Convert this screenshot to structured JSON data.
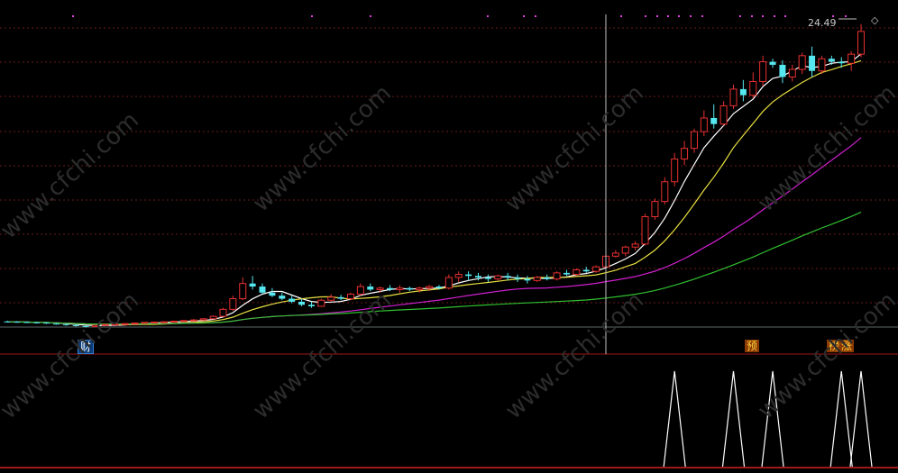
{
  "price_label": "24.49",
  "diamond_glyph": "◇",
  "badges": {
    "cai": "财",
    "yu": "预",
    "bang": "榜",
    "zhang": "涨"
  },
  "watermark_text": "www.cfchi.com",
  "colors": {
    "up": "#e83030",
    "down": "#55e8f0",
    "ma1": "#ffffff",
    "ma2": "#e8e040",
    "ma3": "#d020d0",
    "ma4": "#30c030",
    "grid": "#6a1a1a",
    "cursor": "#c0c0c0",
    "signal": "#ffffff"
  },
  "chart_data": {
    "type": "candlestick",
    "candles": [
      [
        4.9,
        4.95,
        4.84,
        4.88
      ],
      [
        4.88,
        4.92,
        4.82,
        4.86
      ],
      [
        4.86,
        4.9,
        4.8,
        4.84
      ],
      [
        4.84,
        4.88,
        4.78,
        4.82
      ],
      [
        4.82,
        4.85,
        4.74,
        4.76
      ],
      [
        4.76,
        4.8,
        4.7,
        4.72
      ],
      [
        4.72,
        4.76,
        4.62,
        4.66
      ],
      [
        4.66,
        4.7,
        4.56,
        4.6
      ],
      [
        4.6,
        4.64,
        4.5,
        4.56
      ],
      [
        4.56,
        4.66,
        4.54,
        4.64
      ],
      [
        4.64,
        4.72,
        4.6,
        4.7
      ],
      [
        4.7,
        4.76,
        4.66,
        4.72
      ],
      [
        4.72,
        4.78,
        4.68,
        4.76
      ],
      [
        4.76,
        4.82,
        4.72,
        4.8
      ],
      [
        4.8,
        4.86,
        4.76,
        4.84
      ],
      [
        4.84,
        4.9,
        4.8,
        4.86
      ],
      [
        4.86,
        4.92,
        4.82,
        4.88
      ],
      [
        4.88,
        4.96,
        4.84,
        4.92
      ],
      [
        4.92,
        5.0,
        4.88,
        4.96
      ],
      [
        4.96,
        5.06,
        4.92,
        5.0
      ],
      [
        5.0,
        5.1,
        4.96,
        5.08
      ],
      [
        5.08,
        5.3,
        5.04,
        5.24
      ],
      [
        5.24,
        5.8,
        5.2,
        5.7
      ],
      [
        5.7,
        6.6,
        5.6,
        6.4
      ],
      [
        6.4,
        7.8,
        6.3,
        7.4
      ],
      [
        7.4,
        7.9,
        7.0,
        7.2
      ],
      [
        7.2,
        7.4,
        6.7,
        6.8
      ],
      [
        6.8,
        7.1,
        6.5,
        6.6
      ],
      [
        6.6,
        6.8,
        6.3,
        6.4
      ],
      [
        6.4,
        6.6,
        6.1,
        6.2
      ],
      [
        6.2,
        6.4,
        5.9,
        6.0
      ],
      [
        6.0,
        6.2,
        5.8,
        5.9
      ],
      [
        5.9,
        6.4,
        5.86,
        6.3
      ],
      [
        6.3,
        6.7,
        6.2,
        6.5
      ],
      [
        6.5,
        6.66,
        6.3,
        6.4
      ],
      [
        6.4,
        6.8,
        6.3,
        6.7
      ],
      [
        6.7,
        7.4,
        6.6,
        7.2
      ],
      [
        7.2,
        7.4,
        6.9,
        7.0
      ],
      [
        7.0,
        7.2,
        6.8,
        7.1
      ],
      [
        7.1,
        7.3,
        6.9,
        7.0
      ],
      [
        7.0,
        7.3,
        6.8,
        7.1
      ],
      [
        7.1,
        7.2,
        6.9,
        7.0
      ],
      [
        7.0,
        7.2,
        6.8,
        7.1
      ],
      [
        7.1,
        7.3,
        6.9,
        7.2
      ],
      [
        7.2,
        7.3,
        7.0,
        7.1
      ],
      [
        7.1,
        8.0,
        7.0,
        7.8
      ],
      [
        7.8,
        8.2,
        7.5,
        8.0
      ],
      [
        8.0,
        8.2,
        7.6,
        7.9
      ],
      [
        7.9,
        8.1,
        7.6,
        7.8
      ],
      [
        7.8,
        8.0,
        7.5,
        7.7
      ],
      [
        7.7,
        8.0,
        7.6,
        7.9
      ],
      [
        7.9,
        8.1,
        7.6,
        7.8
      ],
      [
        7.8,
        8.0,
        7.5,
        7.7
      ],
      [
        7.7,
        7.9,
        7.4,
        7.6
      ],
      [
        7.6,
        7.9,
        7.5,
        7.8
      ],
      [
        7.8,
        8.0,
        7.6,
        7.7
      ],
      [
        7.7,
        8.2,
        7.6,
        8.1
      ],
      [
        8.1,
        8.3,
        7.9,
        8.0
      ],
      [
        8.0,
        8.4,
        7.9,
        8.3
      ],
      [
        8.3,
        8.5,
        8.1,
        8.2
      ],
      [
        8.2,
        8.6,
        8.1,
        8.5
      ],
      [
        8.5,
        9.3,
        8.4,
        9.2
      ],
      [
        9.2,
        9.6,
        9.1,
        9.4
      ],
      [
        9.4,
        9.9,
        9.2,
        9.8
      ],
      [
        9.8,
        10.2,
        9.6,
        10.0
      ],
      [
        10.0,
        12.0,
        9.9,
        11.8
      ],
      [
        11.8,
        13.0,
        11.6,
        12.8
      ],
      [
        12.8,
        14.4,
        12.6,
        14.1
      ],
      [
        14.1,
        16.0,
        13.8,
        15.6
      ],
      [
        15.6,
        16.8,
        15.2,
        16.3
      ],
      [
        16.3,
        17.6,
        16.0,
        17.4
      ],
      [
        17.4,
        18.8,
        17.1,
        18.3
      ],
      [
        18.3,
        19.2,
        17.6,
        17.9
      ],
      [
        17.9,
        19.4,
        17.8,
        19.1
      ],
      [
        19.1,
        20.5,
        18.9,
        20.2
      ],
      [
        20.2,
        20.8,
        19.4,
        19.8
      ],
      [
        19.8,
        21.3,
        19.6,
        20.7
      ],
      [
        20.7,
        22.4,
        20.4,
        22.0
      ],
      [
        22.0,
        22.2,
        21.6,
        21.8
      ],
      [
        21.8,
        22.1,
        20.6,
        21.0
      ],
      [
        21.0,
        21.8,
        20.7,
        21.5
      ],
      [
        21.5,
        22.6,
        21.2,
        22.4
      ],
      [
        22.4,
        23.0,
        21.0,
        21.4
      ],
      [
        21.4,
        22.4,
        21.2,
        22.2
      ],
      [
        22.2,
        22.4,
        21.8,
        22.0
      ],
      [
        22.0,
        22.3,
        21.6,
        21.9
      ],
      [
        21.9,
        22.7,
        21.4,
        22.5
      ],
      [
        22.5,
        24.49,
        22.3,
        24.0
      ]
    ],
    "signal_peaks": [
      68,
      74,
      78,
      85,
      87
    ],
    "ylim": [
      4.0,
      25.0
    ],
    "indicator": "volume-like spikes"
  }
}
